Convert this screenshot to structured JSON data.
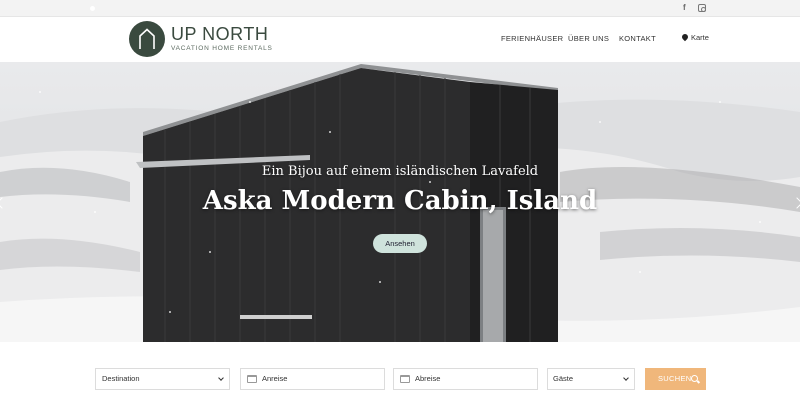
{
  "topbar": {
    "social": [
      {
        "icon": "facebook-icon",
        "label": "f"
      },
      {
        "icon": "instagram-icon"
      }
    ]
  },
  "header": {
    "brand": {
      "name": "UP NORTH",
      "tagline": "VACATION HOME RENTALS",
      "logo_icon": "house-outline-icon"
    },
    "nav": [
      {
        "label": "FERIENHÄUSER"
      },
      {
        "label": "ÜBER UNS"
      },
      {
        "label": "KONTAKT"
      }
    ],
    "map_link": {
      "label": "Karte",
      "icon": "map-pin-icon"
    }
  },
  "hero": {
    "subtitle": "Ein Bijou auf einem isländischen Lavafeld",
    "title": "Aska Modern Cabin, Island",
    "button_label": "Ansehen",
    "prev_icon": "chevron-left-icon",
    "next_icon": "chevron-right-icon"
  },
  "search": {
    "destination": {
      "value": "Destination"
    },
    "arrival": {
      "placeholder": "Anreise",
      "icon": "calendar-icon"
    },
    "departure": {
      "placeholder": "Abreise",
      "icon": "calendar-icon"
    },
    "guests": {
      "value": "Gäste"
    },
    "submit_label": "SUCHEN",
    "submit_icon": "search-icon"
  },
  "colors": {
    "brand_green": "#3a4a3f",
    "button_mint": "#cfe3dc",
    "search_orange": "#f0b77b"
  }
}
